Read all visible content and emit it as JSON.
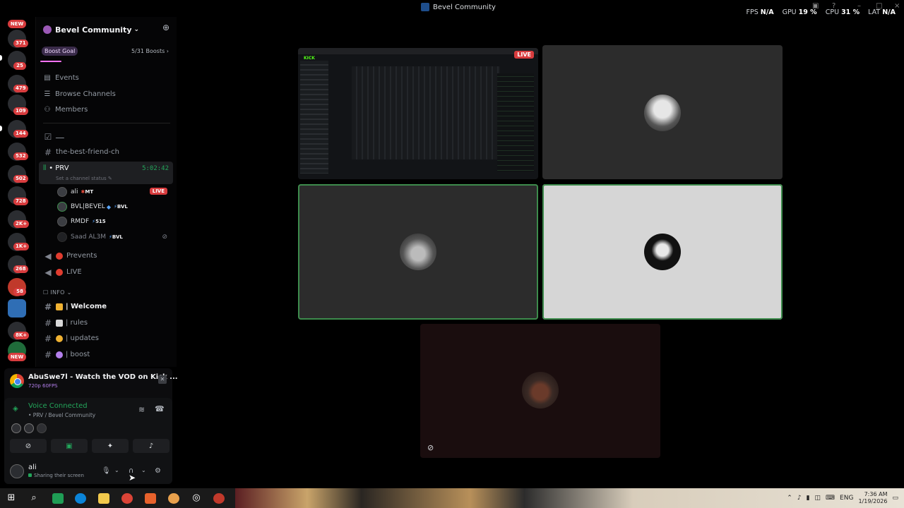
{
  "window": {
    "title": "Bevel Community"
  },
  "stats": {
    "fps_label": "FPS",
    "fps_value": "N/A",
    "gpu_label": "GPU",
    "gpu_value": "19 %",
    "cpu_label": "CPU",
    "cpu_value": "31 %",
    "lat_label": "LAT",
    "lat_value": "N/A"
  },
  "rail": {
    "badges": [
      "NEW",
      "371",
      "25",
      "479",
      "109",
      "144",
      "532",
      "502",
      "728",
      "2K+",
      "1K+",
      "268",
      "58",
      "8K+",
      "NEW"
    ]
  },
  "server": {
    "name": "Bevel Community",
    "boost_goal_label": "Boost Goal",
    "boost_count": "5/31 Boosts",
    "boost_progress": 0.16
  },
  "nav": {
    "events": "Events",
    "browse": "Browse Channels",
    "members": "Members"
  },
  "channels": {
    "arabic": "ــــ",
    "best_friend": "the-best-friend-ch",
    "prv": {
      "name": "• PRV",
      "timer": "5:02:42",
      "status_placeholder": "Set a channel status",
      "users": [
        {
          "name": "ali",
          "tag": "MT",
          "live": "LIVE"
        },
        {
          "name": "BVL|BEVEL",
          "tag": "BVL"
        },
        {
          "name": "RMDF",
          "tag": "515"
        },
        {
          "name": "Saad AL3M",
          "tag": "BVL"
        }
      ]
    },
    "prevents": "Prevents",
    "live": "LIVE",
    "info_category": "INFO",
    "welcome": "| Welcome",
    "rules": "| rules",
    "updates": "| updates",
    "boost": "| boost"
  },
  "activity": {
    "stream_title": "AbuSwe7l - Watch the VOD on Kick ...",
    "stream_quality": "720p 60FPS",
    "voice_status": "Voice Connected",
    "voice_path": "• PRV / Bevel Community"
  },
  "user": {
    "name": "ali",
    "status": "Sharing their screen"
  },
  "stage": {
    "live_label": "LIVE",
    "screen_brand": "KICK"
  },
  "taskbar": {
    "lang": "ENG",
    "time": "7:36 AM",
    "date": "1/19/2026"
  },
  "colors": {
    "accent_green": "#23a55a",
    "live_red": "#d83c3e",
    "boost_pink": "#ff73fa",
    "speaking_border": "#3d8b4c"
  }
}
